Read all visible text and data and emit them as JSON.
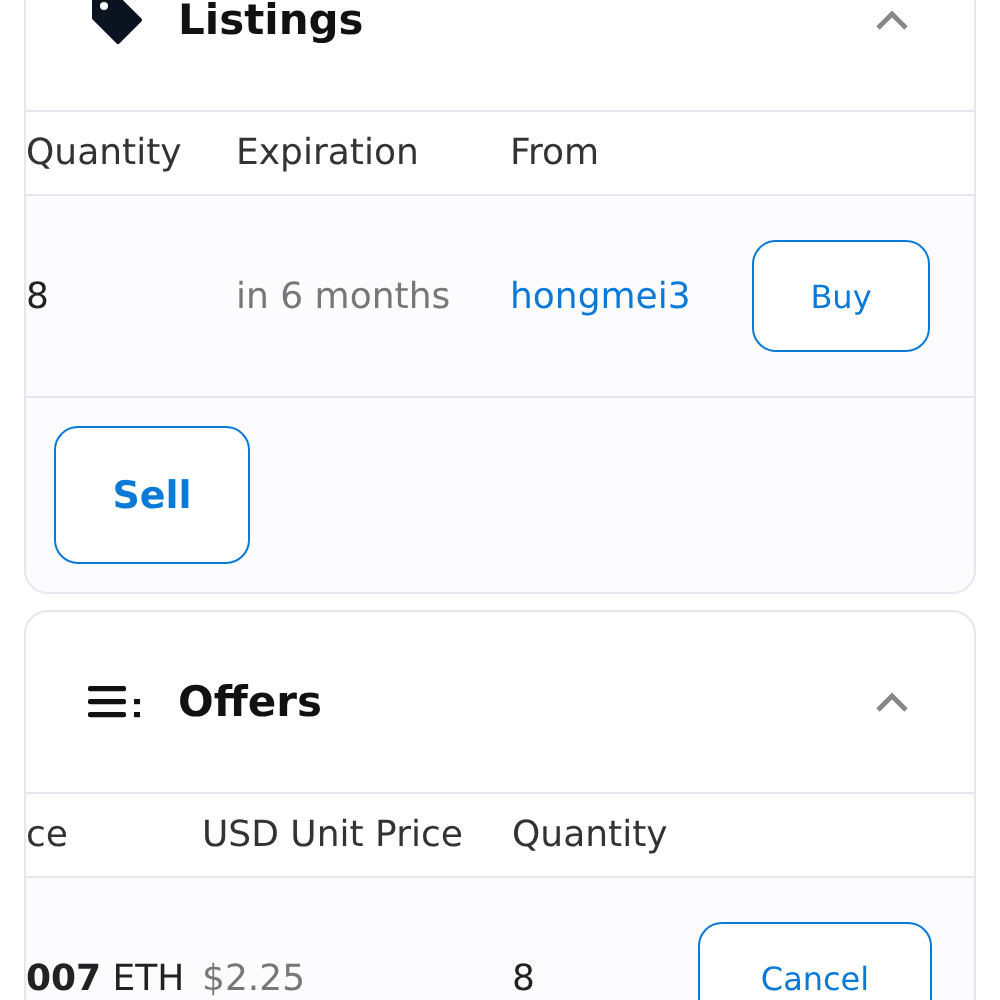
{
  "listings": {
    "title": "Listings",
    "expanded": true,
    "columns": [
      "Quantity",
      "Expiration",
      "From"
    ],
    "rows": [
      {
        "cells": [
          {
            "text": "8",
            "kind": "plain"
          },
          {
            "text": "in 6 months",
            "kind": "muted"
          },
          {
            "text": "hongmei3",
            "kind": "link"
          }
        ],
        "action": "Buy"
      }
    ],
    "footer_button": "Sell"
  },
  "offers": {
    "title": "Offers",
    "expanded": true,
    "columns": [
      "ce",
      "USD Unit Price",
      "Quantity"
    ],
    "rows": [
      {
        "cells": [
          {
            "text": "**007** ETH",
            "kind": "rich"
          },
          {
            "text": "$2.25",
            "kind": "muted"
          },
          {
            "text": "8",
            "kind": "plain"
          }
        ],
        "action": "Cancel"
      }
    ]
  }
}
